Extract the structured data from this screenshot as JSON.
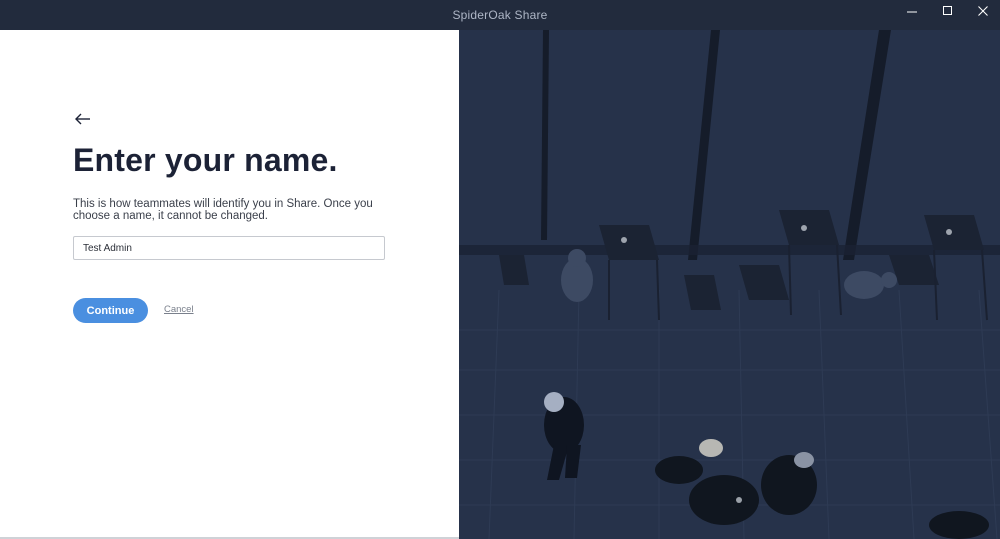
{
  "window": {
    "title": "SpiderOak Share",
    "controls": {
      "minimize": "minimize-icon",
      "maximize": "maximize-icon",
      "close": "close-icon"
    }
  },
  "form": {
    "back_icon": "arrow-left-icon",
    "heading": "Enter your name.",
    "description": "This is how teammates will identify you in Share. Once you choose a name, it cannot be changed.",
    "name_value": "Test Admin",
    "continue_label": "Continue",
    "cancel_label": "Cancel"
  },
  "colors": {
    "titlebar": "#222b3d",
    "accent": "#4a8fe0",
    "heading": "#1c2236",
    "photo_tint": "#253149"
  }
}
